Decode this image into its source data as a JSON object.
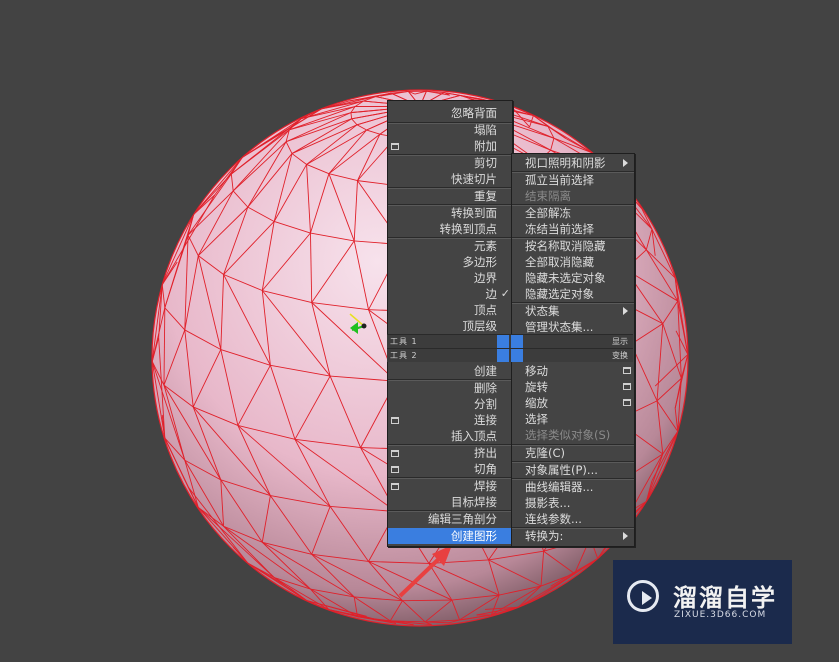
{
  "left_menu": {
    "items": [
      {
        "label": "忽略背面",
        "disabled": false
      },
      {
        "label": "塌陷",
        "disabled": false
      },
      {
        "label": "附加",
        "disabled": false,
        "icon": "settings-box-icon"
      },
      {
        "label": "剪切",
        "disabled": false
      },
      {
        "label": "快速切片",
        "disabled": false
      },
      {
        "label": "重复",
        "disabled": false
      },
      {
        "label": "转换到面",
        "disabled": false
      },
      {
        "label": "转换到顶点",
        "disabled": false
      },
      {
        "label": "元素",
        "disabled": false
      },
      {
        "label": "多边形",
        "disabled": false
      },
      {
        "label": "边界",
        "disabled": false
      },
      {
        "label": "边",
        "disabled": false,
        "checked": true
      },
      {
        "label": "顶点",
        "disabled": false
      },
      {
        "label": "顶层级",
        "disabled": false
      },
      {
        "label": "创建",
        "disabled": false
      },
      {
        "label": "删除",
        "disabled": false
      },
      {
        "label": "分割",
        "disabled": false
      },
      {
        "label": "连接",
        "disabled": false,
        "icon": "settings-box-icon"
      },
      {
        "label": "插入顶点",
        "disabled": false
      },
      {
        "label": "挤出",
        "disabled": false,
        "icon": "settings-box-icon"
      },
      {
        "label": "切角",
        "disabled": false,
        "icon": "settings-box-icon"
      },
      {
        "label": "焊接",
        "disabled": false,
        "icon": "settings-box-icon"
      },
      {
        "label": "目标焊接",
        "disabled": false
      },
      {
        "label": "编辑三角剖分",
        "disabled": false
      },
      {
        "label": "创建图形",
        "disabled": false,
        "selected": true
      }
    ]
  },
  "right_menu": {
    "items": [
      {
        "label": "视口照明和阴影",
        "submenu": true
      },
      {
        "label": "孤立当前选择"
      },
      {
        "label": "结束隔离",
        "disabled": true
      },
      {
        "label": "全部解冻"
      },
      {
        "label": "冻结当前选择"
      },
      {
        "label": "按名称取消隐藏"
      },
      {
        "label": "全部取消隐藏"
      },
      {
        "label": "隐藏未选定对象"
      },
      {
        "label": "隐藏选定对象"
      },
      {
        "label": "状态集",
        "submenu": true
      },
      {
        "label": "管理状态集..."
      },
      {
        "label": "移动",
        "icon": "settings-box-icon"
      },
      {
        "label": "旋转",
        "icon": "settings-box-icon"
      },
      {
        "label": "缩放",
        "icon": "settings-box-icon"
      },
      {
        "label": "选择"
      },
      {
        "label": "选择类似对象(S)",
        "disabled": true
      },
      {
        "label": "克隆(C)"
      },
      {
        "label": "对象属性(P)..."
      },
      {
        "label": "曲线编辑器..."
      },
      {
        "label": "摄影表..."
      },
      {
        "label": "连线参数..."
      },
      {
        "label": "转换为:",
        "submenu": true
      }
    ]
  },
  "quad_labels": {
    "tools1": "工具 1",
    "tools2": "工具 2",
    "display": "显示",
    "transform": "变换"
  },
  "watermark": {
    "title": "溜溜自学",
    "url": "ZIXUE.3D66.COM"
  },
  "colors": {
    "menu_bg": "#444444",
    "selection": "#3a7ee0",
    "wireframe": "#e0202a",
    "sphere": "#f0c8d8",
    "viewport_bg": "#434343",
    "logo_bg": "#1b2a4c"
  }
}
